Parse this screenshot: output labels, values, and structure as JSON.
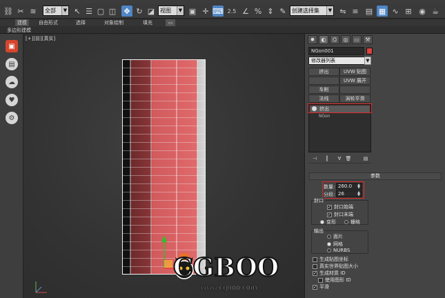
{
  "toolbar": {
    "selection_filter": "全部",
    "ref_coord": "视图",
    "snap_value": "2.5",
    "named_selection": "创建选择集"
  },
  "ribbon": {
    "tabs": [
      "建模",
      "自由形式",
      "选择",
      "对象绘制",
      "填充"
    ],
    "sub_label": "多边形建模"
  },
  "viewport": {
    "label_left": "[+]",
    "label_mid": "[前]",
    "label_right": "[真实]"
  },
  "watermark": {
    "brand": "CGBOO",
    "url": "www.cgboo.com"
  },
  "command_panel": {
    "object_name": "NGon001",
    "object_color": "#d9443f",
    "modifier_list": "修改器列表",
    "modifier_buttons": [
      "挤出",
      "UVW 贴图",
      "",
      "UVW 展开",
      "车削",
      "",
      "法线",
      "涡轮平滑"
    ],
    "stack": [
      "挤出",
      "NGon"
    ],
    "rollout_title": "参数",
    "amount_label": "数量:",
    "amount_value": "260.0",
    "segments_label": "分段:",
    "segments_value": "26",
    "capping": {
      "title": "封口",
      "cap_start": "封口始端",
      "cap_end": "封口末端",
      "morph": "变形",
      "grid": "栅格"
    },
    "output": {
      "title": "输出",
      "patch": "面片",
      "mesh": "网格",
      "nurbs": "NURBS"
    },
    "options": {
      "gen_map": "生成贴图坐标",
      "real_world": "真实世界贴图大小",
      "gen_mat": "生成材质 ID",
      "use_shape": "使用图形 ID",
      "smooth": "平滑"
    }
  }
}
